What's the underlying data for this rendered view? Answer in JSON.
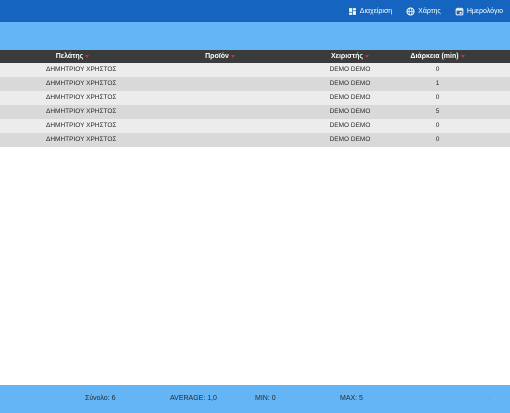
{
  "nav": {
    "items": [
      {
        "label": "Διαχείριση",
        "icon": "dashboard-icon"
      },
      {
        "label": "Χάρτης",
        "icon": "globe-icon"
      },
      {
        "label": "Ημερολόγιο",
        "icon": "calendar-icon"
      }
    ]
  },
  "table": {
    "headers": [
      "Πελάτης",
      "Προϊόν",
      "Χειριστής",
      "Διάρκεια (min)"
    ],
    "rows": [
      {
        "customer": "ΔΗΜΗΤΡΙΟΥ ΧΡΗΣΤΟΣ",
        "product": "",
        "operator": "DEMO DEMO",
        "duration": "0"
      },
      {
        "customer": "ΔΗΜΗΤΡΙΟΥ ΧΡΗΣΤΟΣ",
        "product": "",
        "operator": "DEMO DEMO",
        "duration": "1"
      },
      {
        "customer": "ΔΗΜΗΤΡΙΟΥ ΧΡΗΣΤΟΣ",
        "product": "",
        "operator": "DEMO DEMO",
        "duration": "0"
      },
      {
        "customer": "ΔΗΜΗΤΡΙΟΥ ΧΡΗΣΤΟΣ",
        "product": "",
        "operator": "DEMO DEMO",
        "duration": "5"
      },
      {
        "customer": "ΔΗΜΗΤΡΙΟΥ ΧΡΗΣΤΟΣ",
        "product": "",
        "operator": "DEMO DEMO",
        "duration": "0"
      },
      {
        "customer": "ΔΗΜΗΤΡΙΟΥ ΧΡΗΣΤΟΣ",
        "product": "",
        "operator": "DEMO DEMO",
        "duration": "0"
      }
    ]
  },
  "footer": {
    "total": "Σύνολο: 6",
    "average": "AVERAGE: 1,0",
    "min": "MIN: 0",
    "max": "MAX: 5",
    "prev_label": "‹"
  },
  "colors": {
    "nav_background": "#1565c0",
    "band_background": "#64b5f6",
    "header_background": "#3b3b3b",
    "row_light": "#ececec",
    "row_dark": "#d9d9d9",
    "sort_indicator": "#d32f2f",
    "text": "#2b2b2b"
  }
}
